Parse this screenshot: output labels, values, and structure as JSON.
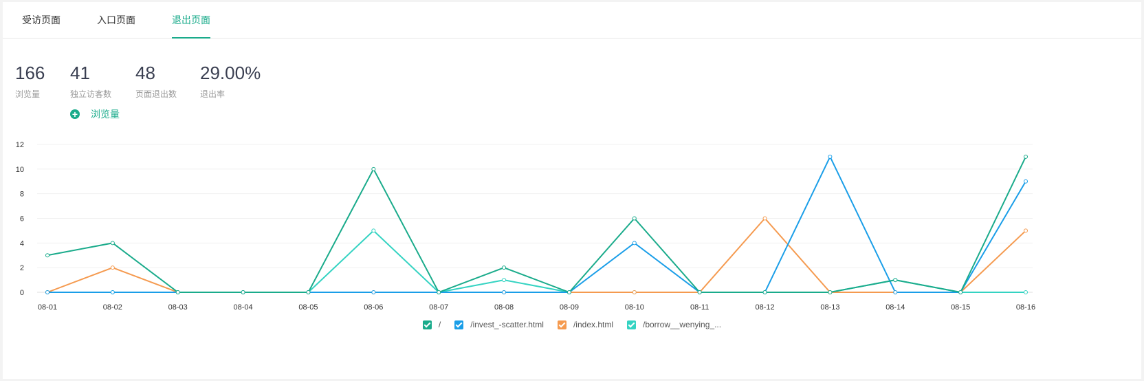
{
  "tabs": [
    {
      "label": "受访页面",
      "active": false
    },
    {
      "label": "入口页面",
      "active": false
    },
    {
      "label": "退出页面",
      "active": true
    }
  ],
  "stats": [
    {
      "value": "166",
      "label": "浏览量"
    },
    {
      "value": "41",
      "label": "独立访客数"
    },
    {
      "value": "48",
      "label": "页面退出数"
    },
    {
      "value": "29.00%",
      "label": "退出率"
    }
  ],
  "add_metric": {
    "label": "浏览量"
  },
  "chart_data": {
    "type": "line",
    "x": [
      "08-01",
      "08-02",
      "08-03",
      "08-04",
      "08-05",
      "08-06",
      "08-07",
      "08-08",
      "08-09",
      "08-10",
      "08-11",
      "08-12",
      "08-13",
      "08-14",
      "08-15",
      "08-16"
    ],
    "ylim": [
      0,
      12
    ],
    "yticks": [
      0,
      2,
      4,
      6,
      8,
      10,
      12
    ],
    "grid": true,
    "legend_position": "bottom",
    "series": [
      {
        "name": "/",
        "color": "#1aab8b",
        "values": [
          3,
          4,
          0,
          0,
          0,
          10,
          0,
          2,
          0,
          6,
          0,
          0,
          0,
          1,
          0,
          11
        ]
      },
      {
        "name": "/invest_-scatter.html",
        "color": "#1a9ee8",
        "values": [
          0,
          0,
          0,
          0,
          0,
          0,
          0,
          0,
          0,
          4,
          0,
          0,
          11,
          0,
          0,
          9
        ]
      },
      {
        "name": "/index.html",
        "color": "#f59a4f",
        "values": [
          0,
          2,
          0,
          0,
          0,
          0,
          0,
          0,
          0,
          0,
          0,
          6,
          0,
          0,
          0,
          5
        ]
      },
      {
        "name": "/borrow__wenying_...",
        "color": "#34d3c2",
        "values": [
          0,
          0,
          0,
          0,
          0,
          5,
          0,
          1,
          0,
          0,
          0,
          0,
          0,
          1,
          0,
          0
        ]
      }
    ]
  }
}
